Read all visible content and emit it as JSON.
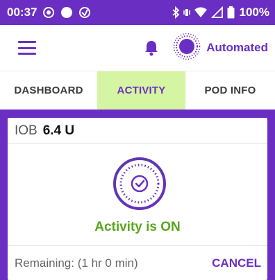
{
  "status_bar": {
    "time": "00:37",
    "battery": "100%",
    "icons": [
      "ring-icon",
      "dot-icon",
      "data-saver-icon",
      "bluetooth-icon",
      "vibrate-icon",
      "wifi-icon",
      "signal-icon",
      "battery-icon"
    ]
  },
  "app_bar": {
    "menu_icon": "hamburger-menu-icon",
    "notification_icon": "bell-icon",
    "mode_icon": "sun-mode-icon",
    "mode_label": "Automated"
  },
  "tabs": [
    {
      "label": "DASHBOARD",
      "selected": false
    },
    {
      "label": "ACTIVITY",
      "selected": true
    },
    {
      "label": "POD INFO",
      "selected": false
    }
  ],
  "card": {
    "iob_label": "IOB",
    "iob_value": "6.4 U",
    "activity_icon": "activity-check-icon",
    "status_text": "Activity is ON",
    "remaining_text": "Remaining: (1 hr 0 min)",
    "cancel_label": "CANCEL"
  },
  "colors": {
    "brand": "#6a2fc2",
    "tab_selected_bg": "#d5f5a2",
    "status_on": "#5aa51e"
  }
}
